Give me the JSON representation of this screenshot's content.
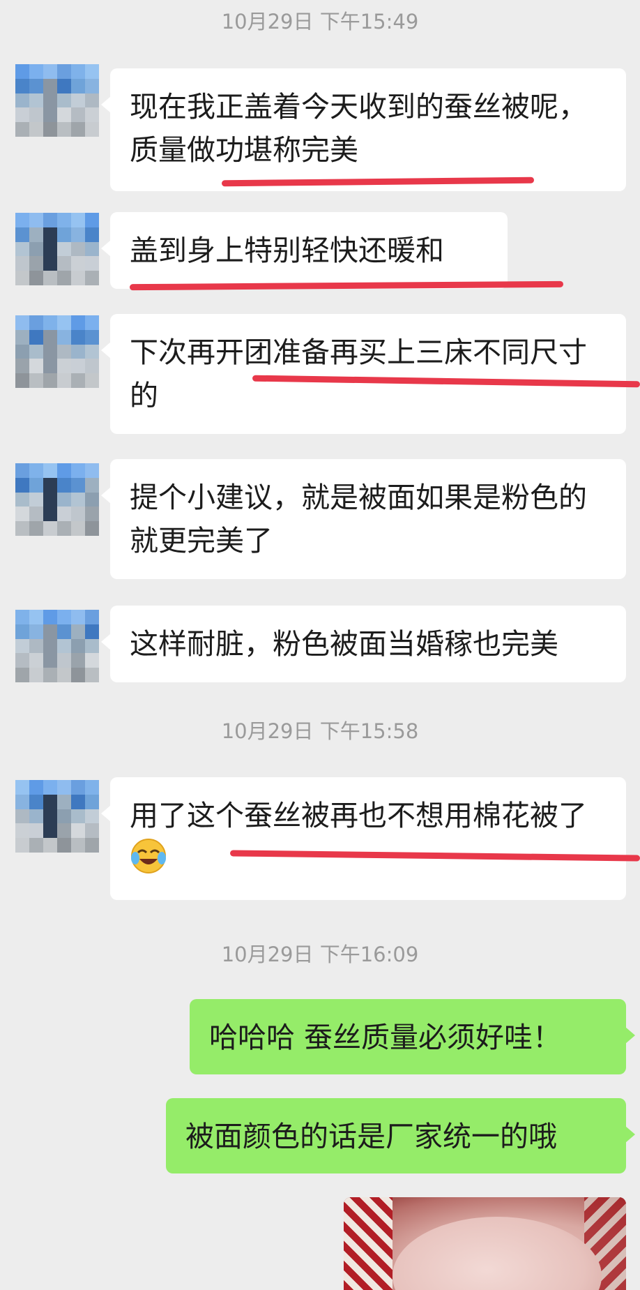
{
  "colors": {
    "background": "#ededed",
    "incoming_bubble": "#ffffff",
    "outgoing_bubble": "#95ec69",
    "timestamp_text": "#9a9a9a",
    "annotation_underline": "#e8384a"
  },
  "timestamps": [
    "10月29日 下午15:49",
    "10月29日 下午15:58",
    "10月29日 下午16:09"
  ],
  "messages": [
    {
      "side": "left",
      "text": "现在我正盖着今天收到的蚕丝被呢，质量做功堪称完美",
      "underlined": true
    },
    {
      "side": "left",
      "text": "盖到身上特别轻快还暖和",
      "underlined": true
    },
    {
      "side": "left",
      "text": "下次再开团准备再买上三床不同尺寸的",
      "underlined": true
    },
    {
      "side": "left",
      "text": "提个小建议，就是被面如果是粉色的就更完美了",
      "underlined": false
    },
    {
      "side": "left",
      "text": "这样耐脏，粉色被面当婚稼也完美",
      "underlined": false
    },
    {
      "side": "left",
      "text": "用了这个蚕丝被再也不想用棉花被了",
      "emoji": "laughing-crying-emoji",
      "underlined": true
    },
    {
      "side": "right",
      "text": "哈哈哈 蚕丝质量必须好哇！",
      "underlined": false
    },
    {
      "side": "right",
      "text": "被面颜色的话是厂家统一的哦",
      "underlined": false
    }
  ],
  "avatar_icon": "pixelated-avatar",
  "image_message_icon": "photo-thumbnail"
}
